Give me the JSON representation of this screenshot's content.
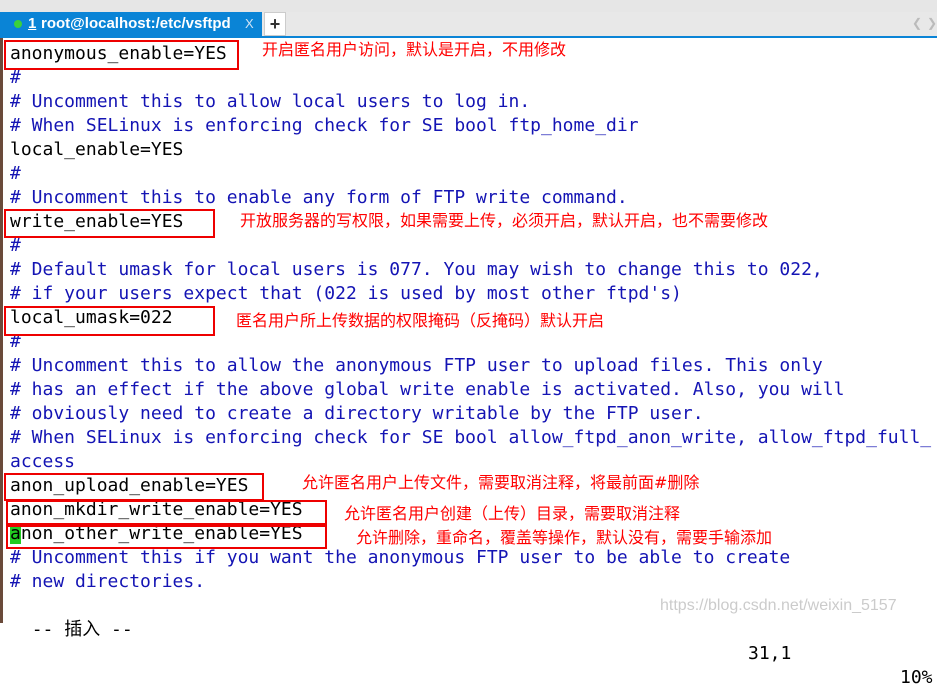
{
  "tab": {
    "number": "1",
    "title": "root@localhost:/etc/vsftpd",
    "close": "X",
    "new_tab": "+",
    "status_color": "#3bd13b",
    "accent": "#0a84d6"
  },
  "lines": [
    {
      "text": "anonymous_enable=YES",
      "comment": false
    },
    {
      "text": "#",
      "comment": true
    },
    {
      "text": "# Uncomment this to allow local users to log in.",
      "comment": true
    },
    {
      "text": "# When SELinux is enforcing check for SE bool ftp_home_dir",
      "comment": true
    },
    {
      "text": "local_enable=YES",
      "comment": false
    },
    {
      "text": "#",
      "comment": true
    },
    {
      "text": "# Uncomment this to enable any form of FTP write command.",
      "comment": true
    },
    {
      "text": "write_enable=YES",
      "comment": false
    },
    {
      "text": "#",
      "comment": true
    },
    {
      "text": "# Default umask for local users is 077. You may wish to change this to 022,",
      "comment": true
    },
    {
      "text": "# if your users expect that (022 is used by most other ftpd's)",
      "comment": true
    },
    {
      "text": "local_umask=022",
      "comment": false
    },
    {
      "text": "#",
      "comment": true
    },
    {
      "text": "# Uncomment this to allow the anonymous FTP user to upload files. This only",
      "comment": true
    },
    {
      "text": "# has an effect if the above global write enable is activated. Also, you will",
      "comment": true
    },
    {
      "text": "# obviously need to create a directory writable by the FTP user.",
      "comment": true
    },
    {
      "text": "# When SELinux is enforcing check for SE bool allow_ftpd_anon_write, allow_ftpd_full_",
      "comment": true
    },
    {
      "text": "access",
      "comment": true
    },
    {
      "text": "anon_upload_enable=YES",
      "comment": false
    },
    {
      "text": "anon_mkdir_write_enable=YES",
      "comment": false
    },
    {
      "text": "anon_other_write_enable=YES",
      "comment": false,
      "cursor": true
    },
    {
      "text": "# Uncomment this if you want the anonymous FTP user to be able to create",
      "comment": true
    },
    {
      "text": "# new directories.",
      "comment": true
    }
  ],
  "annotations": [
    "开启匿名用户访问，默认是开启，不用修改",
    "开放服务器的写权限，如果需要上传，必须开启，默认开启，也不需要修改",
    "匿名用户所上传数据的权限掩码（反掩码）默认开启",
    "允许匿名用户上传文件，需要取消注释，将最前面#删除",
    "允许匿名用户创建（上传）目录，需要取消注释",
    "允许删除，重命名，覆盖等操作，默认没有，需要手输添加"
  ],
  "status": {
    "mode": "-- 插入 --",
    "position": "31,1",
    "percent": "10%"
  },
  "watermark": "https://blog.csdn.net/weixin_5157",
  "colors": {
    "comment": "#1414b4",
    "annotation": "#ff0000",
    "cursor": "#22cc22"
  }
}
